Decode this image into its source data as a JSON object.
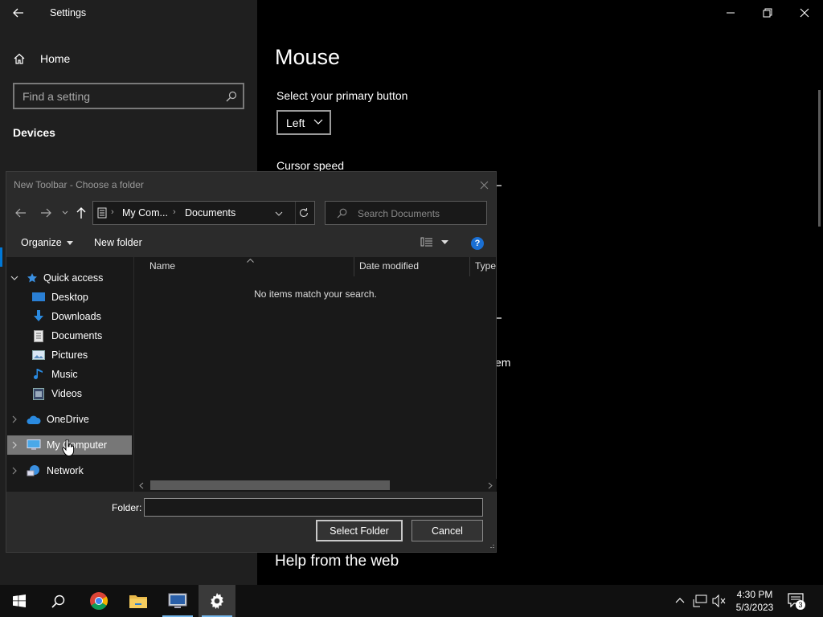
{
  "settings": {
    "title": "Settings",
    "home_label": "Home",
    "search_placeholder": "Find a setting",
    "section_label": "Devices",
    "page_title": "Mouse",
    "primary_button_label": "Select your primary button",
    "primary_button_value": "Left",
    "cursor_speed_label": "Cursor speed",
    "partial_text": "em",
    "help_heading": "Help from the web"
  },
  "dialog": {
    "title": "New Toolbar - Choose a folder",
    "breadcrumb": [
      "My Com...",
      "Documents"
    ],
    "search_placeholder": "Search Documents",
    "organize_label": "Organize",
    "new_folder_label": "New folder",
    "columns": [
      "Name",
      "Date modified",
      "Type"
    ],
    "empty_message": "No items match your search.",
    "folder_label": "Folder:",
    "folder_value": "",
    "select_button": "Select Folder",
    "cancel_button": "Cancel",
    "nav": {
      "quick_access": "Quick access",
      "items": [
        "Desktop",
        "Downloads",
        "Documents",
        "Pictures",
        "Music",
        "Videos"
      ],
      "onedrive": "OneDrive",
      "my_computer": "My Computer",
      "network": "Network"
    }
  },
  "taskbar": {
    "time": "4:30 PM",
    "date": "5/3/2023",
    "notification_count": "3"
  },
  "colors": {
    "accent": "#0078d7",
    "selection": "#777777",
    "folder_yellow": "#e8b84a"
  }
}
